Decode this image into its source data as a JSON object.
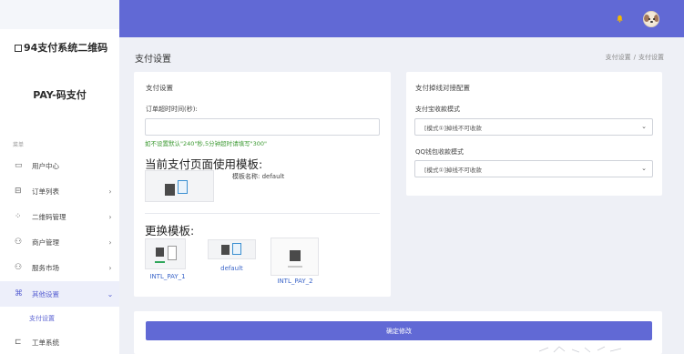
{
  "sidebar": {
    "brand": "94支付系统二维码",
    "app_name": "PAY-码支付",
    "menu_caption": "菜单",
    "items": [
      {
        "label": "用户中心",
        "icon": "monitor-icon",
        "arrow": ""
      },
      {
        "label": "订单列表",
        "icon": "list-icon",
        "arrow": "›"
      },
      {
        "label": "二维码管理",
        "icon": "qrcode-icon",
        "arrow": "›"
      },
      {
        "label": "商户管理",
        "icon": "users-icon",
        "arrow": "›"
      },
      {
        "label": "服务市场",
        "icon": "users-icon",
        "arrow": "›"
      },
      {
        "label": "其他设置",
        "icon": "command-icon",
        "arrow": "⌄"
      },
      {
        "label": "工单系统",
        "icon": "ticket-icon",
        "arrow": ""
      }
    ],
    "sub_item": "支付设置"
  },
  "header": {
    "accent_color": "#6169d5"
  },
  "page": {
    "title": "支付设置",
    "breadcrumb": [
      "支付设置",
      "支付设置"
    ],
    "breadcrumb_sep": "/"
  },
  "pay_settings": {
    "title": "支付设置",
    "timeout_label": "订单超时时间(秒):",
    "timeout_value": "",
    "timeout_hint": "如不设置默认\"240\"秒,5分钟超时请填写\"300\"",
    "current_template_heading": "当前支付页面使用模板:",
    "current_template_name": "模板名称: default",
    "change_template_heading": "更换模板:",
    "templates": [
      {
        "label": "INTL_PAY_1"
      },
      {
        "label": "default"
      },
      {
        "label": "INTL_PAY_2"
      }
    ]
  },
  "disconnect_config": {
    "title": "支付掉线对接配置",
    "alipay_label": "支付宝收款模式",
    "alipay_value": "[模式①]掉线不可收款",
    "qq_label": "QQ钱包收款模式",
    "qq_value": "[模式①]掉线不可收款"
  },
  "actions": {
    "confirm_label": "确定修改"
  }
}
